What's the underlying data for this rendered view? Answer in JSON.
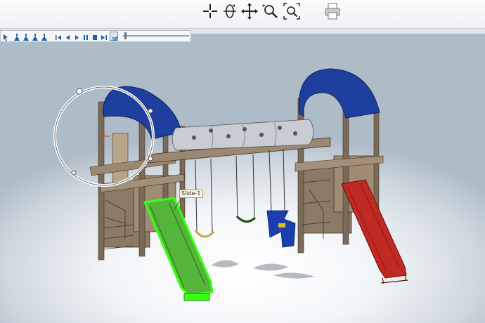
{
  "toolbar": {
    "tools": [
      {
        "name": "select-tool",
        "icon": "crosshair-icon"
      },
      {
        "name": "rotate-tool",
        "icon": "rotate-icon"
      },
      {
        "name": "pan-tool",
        "icon": "pan-icon"
      },
      {
        "name": "zoom-tool",
        "icon": "zoom-icon"
      },
      {
        "name": "zoom-window-tool",
        "icon": "zoom-window-icon"
      },
      {
        "name": "print-tool",
        "icon": "printer-icon"
      }
    ]
  },
  "animation_bar": {
    "buttons": [
      "pointer-icon",
      "viewpoint-1-icon",
      "viewpoint-2-icon",
      "viewpoint-3-icon",
      "viewpoint-4-icon",
      "skip-start-icon",
      "step-back-icon",
      "play-icon",
      "pause-icon",
      "stop-icon",
      "skip-end-icon",
      "loop-icon"
    ],
    "timeline_position": 0.02
  },
  "model": {
    "highlighted_part_label": "Slide-1",
    "colors": {
      "canopy": "#1f3f9e",
      "wood": "#8c7a66",
      "tube": "#c9ccd2",
      "selected_slide": "#55b53a",
      "selection_outline": "#39ff14",
      "red_slide": "#c02a22",
      "glider": "#1b3fb0",
      "background": "#dfe5ea"
    }
  }
}
